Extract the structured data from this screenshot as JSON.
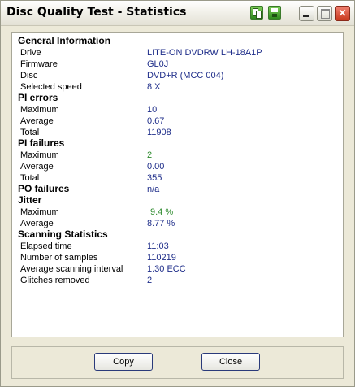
{
  "window": {
    "title": "Disc Quality Test - Statistics"
  },
  "titlebar_icons": {
    "copy": "copy-icon",
    "save": "save-icon"
  },
  "sections": {
    "general": {
      "title": "General Information",
      "drive_label": "Drive",
      "drive_value": "LITE-ON DVDRW LH-18A1P",
      "firmware_label": "Firmware",
      "firmware_value": "GL0J",
      "disc_label": "Disc",
      "disc_value": "DVD+R (MCC 004)",
      "speed_label": "Selected speed",
      "speed_value": "8 X"
    },
    "pi_errors": {
      "title": "PI errors",
      "max_label": "Maximum",
      "max_value": "10",
      "avg_label": "Average",
      "avg_value": "0.67",
      "total_label": "Total",
      "total_value": "11908"
    },
    "pi_failures": {
      "title": "PI failures",
      "max_label": "Maximum",
      "max_value": "2",
      "avg_label": "Average",
      "avg_value": "0.00",
      "total_label": "Total",
      "total_value": "355"
    },
    "po_failures": {
      "title": "PO failures",
      "value": "n/a"
    },
    "jitter": {
      "title": "Jitter",
      "max_label": "Maximum",
      "max_value": "9.4 %",
      "avg_label": "Average",
      "avg_value": "8.77 %"
    },
    "scanning": {
      "title": "Scanning Statistics",
      "elapsed_label": "Elapsed time",
      "elapsed_value": "11:03",
      "samples_label": "Number of samples",
      "samples_value": "110219",
      "interval_label": "Average scanning interval",
      "interval_value": "1.30 ECC",
      "glitches_label": "Glitches removed",
      "glitches_value": "2"
    }
  },
  "buttons": {
    "copy": "Copy",
    "close": "Close"
  },
  "colors": {
    "value_text": "#1f2e8a",
    "good_value": "#2d8a2d",
    "close_button": "#c8381c"
  }
}
